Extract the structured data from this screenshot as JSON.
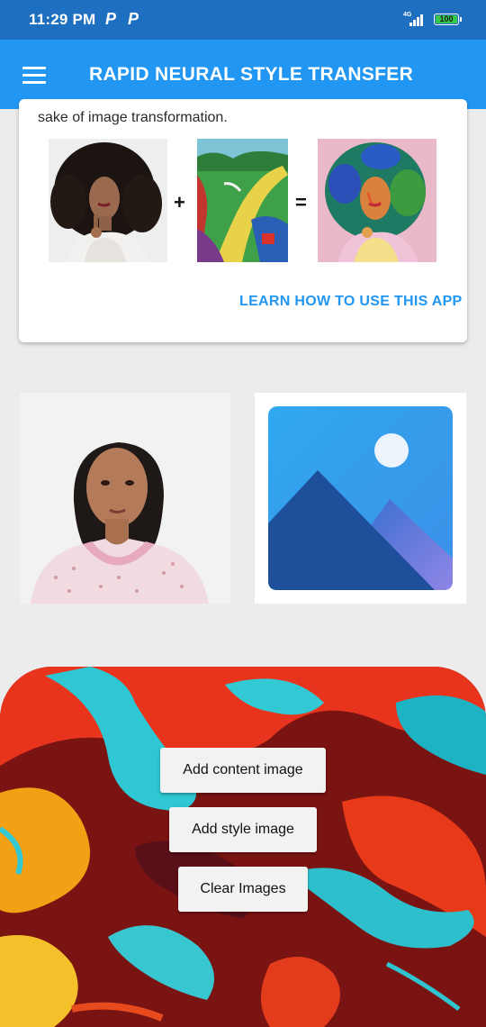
{
  "status_bar": {
    "time": "11:29 PM",
    "notification_icons": [
      "P",
      "P"
    ],
    "network": "4G",
    "battery": "100"
  },
  "app_bar": {
    "title": "RAPID NEURAL STYLE TRANSFER",
    "menu_icon": "hamburger-menu-icon"
  },
  "info_card": {
    "intro_text": "sake of image transformation.",
    "plus_sign": "+",
    "equals_sign": "=",
    "learn_link": "LEARN HOW TO USE THIS APP"
  },
  "buttons": {
    "add_content": "Add content image",
    "add_style": "Add style image",
    "clear": "Clear Images"
  },
  "colors": {
    "status_bar": "#1e6fc0",
    "app_bar": "#2196f3",
    "accent": "#2196f3",
    "background": "#ececec"
  }
}
